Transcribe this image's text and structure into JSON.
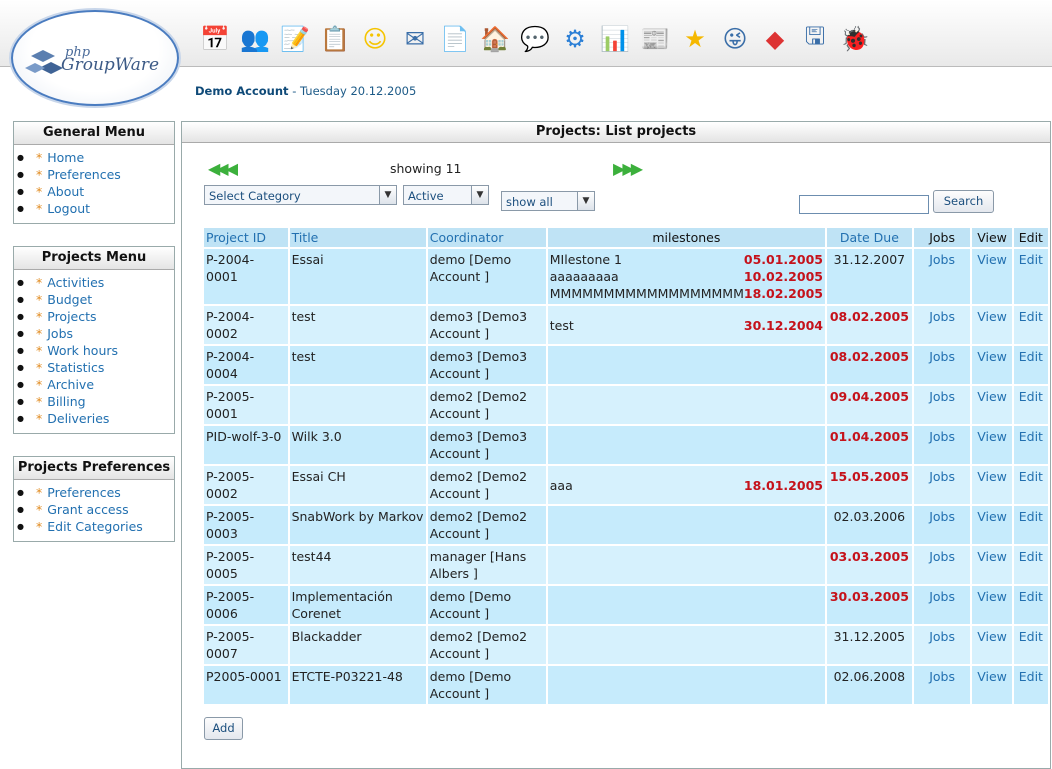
{
  "header": {
    "account_name": "Demo Account",
    "account_date": " - Tuesday 20.12.2005",
    "logo_text": "phpGroupWare",
    "app_icons": [
      "calendar-icon",
      "addressbook-icon",
      "notes-icon",
      "todo-icon",
      "smiley-icon",
      "email-icon",
      "projects-icon",
      "bookmarks-icon",
      "chat-icon",
      "preferences-icon",
      "charts-icon",
      "news-icon",
      "star-icon",
      "emoticon-icon",
      "blocks-icon",
      "ftp-icon",
      "bug-icon"
    ]
  },
  "general_menu": {
    "title": "General Menu",
    "items": [
      "Home",
      "Preferences",
      "About",
      "Logout"
    ]
  },
  "projects_menu": {
    "title": "Projects Menu",
    "items": [
      "Activities",
      "Budget",
      "Projects",
      "Jobs",
      "Work hours",
      "Statistics",
      "Archive",
      "Billing",
      "Deliveries"
    ]
  },
  "projects_prefs": {
    "title": "Projects Preferences",
    "items": [
      "Preferences",
      "Grant access",
      "Edit Categories"
    ]
  },
  "main": {
    "title": "Projects: List projects",
    "showing": "showing 11",
    "category_select": "Select Category",
    "status_select": "Active",
    "filter_select": "show all",
    "search_button": "Search",
    "add_button": "Add",
    "columns": [
      "Project ID",
      "Title",
      "Coordinator",
      "milestones",
      "Date Due",
      "Jobs",
      "View",
      "Edit"
    ],
    "rows": [
      {
        "id": "P-2004-0001",
        "title": "Essai",
        "coord": "demo [Demo Account ]",
        "ms": [
          [
            "MIlestone 1",
            "05.01.2005"
          ],
          [
            "aaaaaaaaa",
            "10.02.2005"
          ],
          [
            "MMMMMMMMMMMMMMMMMM",
            "18.02.2005"
          ]
        ],
        "due": "31.12.2007",
        "due_red": false,
        "jobs": "Jobs",
        "view": "View",
        "edit": "Edit"
      },
      {
        "id": "P-2004-0002",
        "title": "test",
        "coord": "demo3 [Demo3 Account ]",
        "ms": [
          [
            "test",
            "30.12.2004"
          ]
        ],
        "due": "08.02.2005",
        "due_red": true,
        "jobs": "Jobs",
        "view": "View",
        "edit": "Edit"
      },
      {
        "id": "P-2004-0004",
        "title": "test",
        "coord": "demo3 [Demo3 Account ]",
        "ms": [],
        "due": "08.02.2005",
        "due_red": true,
        "jobs": "Jobs",
        "view": "View",
        "edit": "Edit"
      },
      {
        "id": "P-2005-0001",
        "title": "",
        "coord": "demo2 [Demo2 Account ]",
        "ms": [],
        "due": "09.04.2005",
        "due_red": true,
        "jobs": "Jobs",
        "view": "View",
        "edit": "Edit"
      },
      {
        "id": "PID-wolf-3-0",
        "title": "Wilk 3.0",
        "coord": "demo3 [Demo3 Account ]",
        "ms": [],
        "due": "01.04.2005",
        "due_red": true,
        "jobs": "Jobs",
        "view": "View",
        "edit": "Edit"
      },
      {
        "id": "P-2005-0002",
        "title": "Essai CH",
        "coord": "demo2 [Demo2 Account ]",
        "ms": [
          [
            "aaa",
            "18.01.2005"
          ]
        ],
        "due": "15.05.2005",
        "due_red": true,
        "jobs": "Jobs",
        "view": "View",
        "edit": "Edit"
      },
      {
        "id": "P-2005-0003",
        "title": "SnabWork by Markov",
        "coord": "demo2 [Demo2 Account ]",
        "ms": [],
        "due": "02.03.2006",
        "due_red": false,
        "jobs": "Jobs",
        "view": "View",
        "edit": "Edit"
      },
      {
        "id": "P-2005-0005",
        "title": "test44",
        "coord": "manager [Hans Albers ]",
        "ms": [],
        "due": "03.03.2005",
        "due_red": true,
        "jobs": "Jobs",
        "view": "View",
        "edit": "Edit"
      },
      {
        "id": "P-2005-0006",
        "title": "Implementación Corenet",
        "coord": "demo [Demo Account ]",
        "ms": [],
        "due": "30.03.2005",
        "due_red": true,
        "jobs": "Jobs",
        "view": "View",
        "edit": "Edit"
      },
      {
        "id": "P-2005-0007",
        "title": "Blackadder",
        "coord": "demo2 [Demo2 Account ]",
        "ms": [],
        "due": "31.12.2005",
        "due_red": false,
        "jobs": "Jobs",
        "view": "View",
        "edit": "Edit"
      },
      {
        "id": "P2005-0001",
        "title": "ETCTE-P03221-48",
        "coord": "demo [Demo Account ]",
        "ms": [],
        "due": "02.06.2008",
        "due_red": false,
        "jobs": "Jobs",
        "view": "View",
        "edit": "Edit"
      }
    ]
  }
}
